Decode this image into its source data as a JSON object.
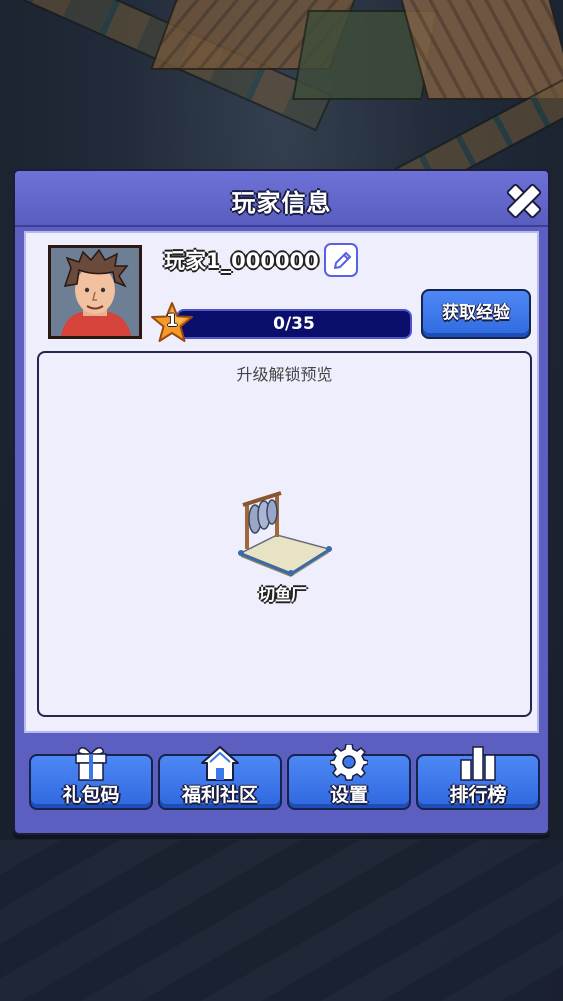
{
  "modal": {
    "title": "玩家信息"
  },
  "player": {
    "name": "玩家1_000000",
    "level": "1",
    "xp_text": "0/35",
    "xp_progress": 0
  },
  "actions": {
    "get_xp_label": "获取经验"
  },
  "preview": {
    "title": "升级解锁预览",
    "items": [
      {
        "label": "切鱼厂",
        "icon": "fish-cutting-factory-icon"
      }
    ]
  },
  "bottom_buttons": [
    {
      "label": "礼包码",
      "icon": "gift-icon"
    },
    {
      "label": "福利社区",
      "icon": "house-icon"
    },
    {
      "label": "设置",
      "icon": "gear-icon"
    },
    {
      "label": "排行榜",
      "icon": "leaderboard-icon"
    }
  ],
  "colors": {
    "panel_purple": "#5c5fbf",
    "button_blue": "#3b78ea",
    "xp_bar": "#0b0f6b",
    "star_orange": "#f59a2a"
  }
}
